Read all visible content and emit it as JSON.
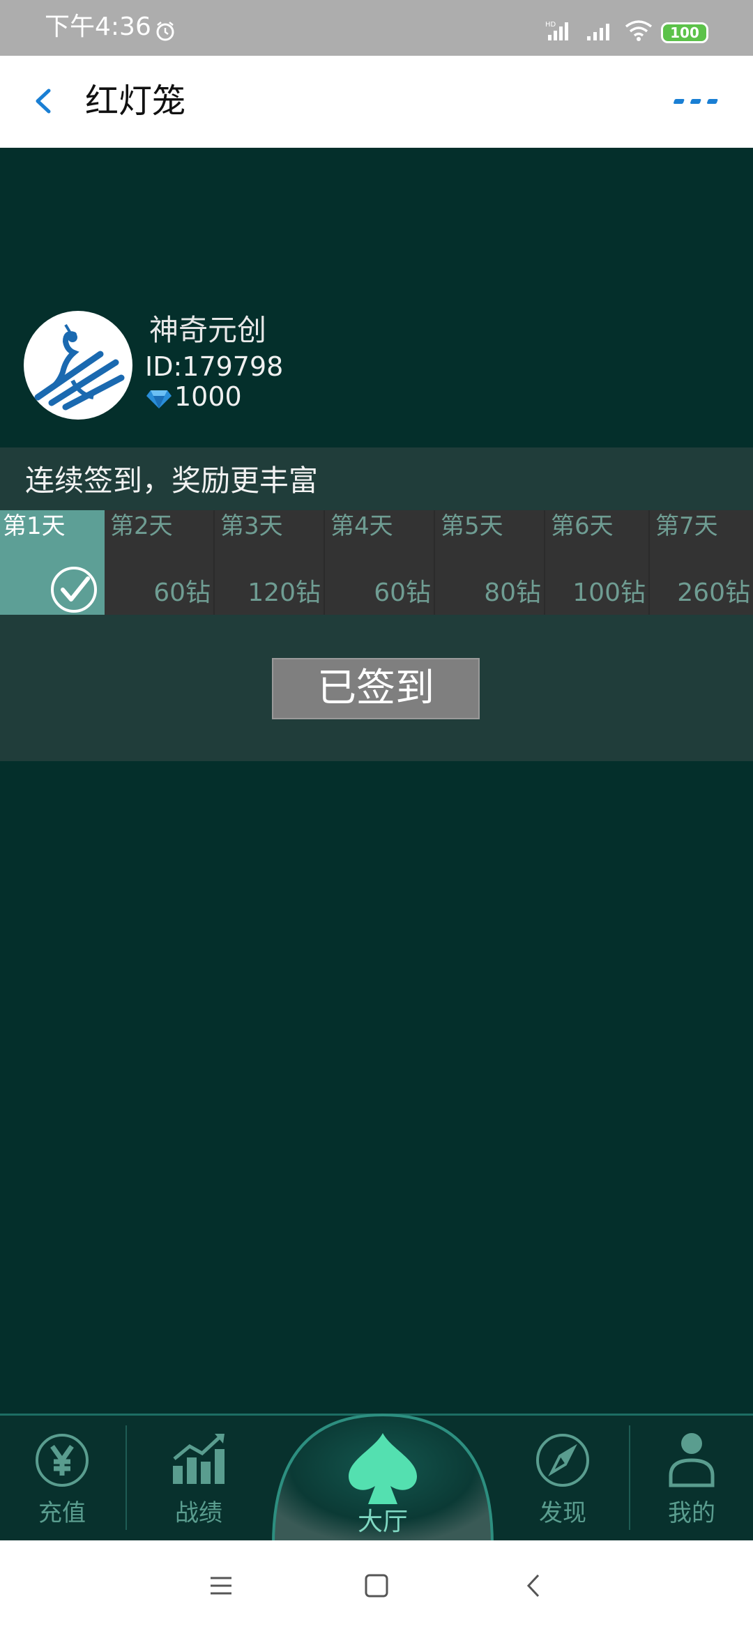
{
  "status_bar": {
    "time": "下午4:36",
    "battery": "100",
    "icons": [
      "alarm-icon",
      "hd-signal-icon",
      "signal-icon",
      "wifi-icon",
      "battery-icon"
    ]
  },
  "header": {
    "title": "红灯笼",
    "back_icon": "chevron-left-icon",
    "more_icon": "more-dots-icon",
    "accent_color": "#1a7fd4"
  },
  "profile": {
    "name": "神奇元创",
    "id": "ID:179798",
    "diamonds": "1000",
    "avatar_icon": "peacock-logo-icon"
  },
  "signin": {
    "header": "连续签到，奖励更丰富",
    "days": [
      {
        "label": "第1天",
        "reward": "",
        "claimed": true
      },
      {
        "label": "第2天",
        "reward": "60钻",
        "claimed": false
      },
      {
        "label": "第3天",
        "reward": "120钻",
        "claimed": false
      },
      {
        "label": "第4天",
        "reward": "60钻",
        "claimed": false
      },
      {
        "label": "第5天",
        "reward": "80钻",
        "claimed": false
      },
      {
        "label": "第6天",
        "reward": "100钻",
        "claimed": false
      },
      {
        "label": "第7天",
        "reward": "260钻",
        "claimed": false
      }
    ],
    "button_label": "已签到"
  },
  "bottom_nav": {
    "items": [
      {
        "label": "充值",
        "icon": "yen-circle-icon"
      },
      {
        "label": "战绩",
        "icon": "bar-chart-icon"
      },
      {
        "label": "大厅",
        "icon": "spade-icon"
      },
      {
        "label": "发现",
        "icon": "compass-icon"
      },
      {
        "label": "我的",
        "icon": "user-icon"
      }
    ],
    "active": "大厅"
  },
  "system_nav": {
    "icons": [
      "menu-icon",
      "home-icon",
      "back-icon"
    ]
  },
  "colors": {
    "background": "#042f2b",
    "panel": "#203d3a",
    "active_day": "#5d9f96",
    "nav_accent": "#5a9d8f"
  }
}
